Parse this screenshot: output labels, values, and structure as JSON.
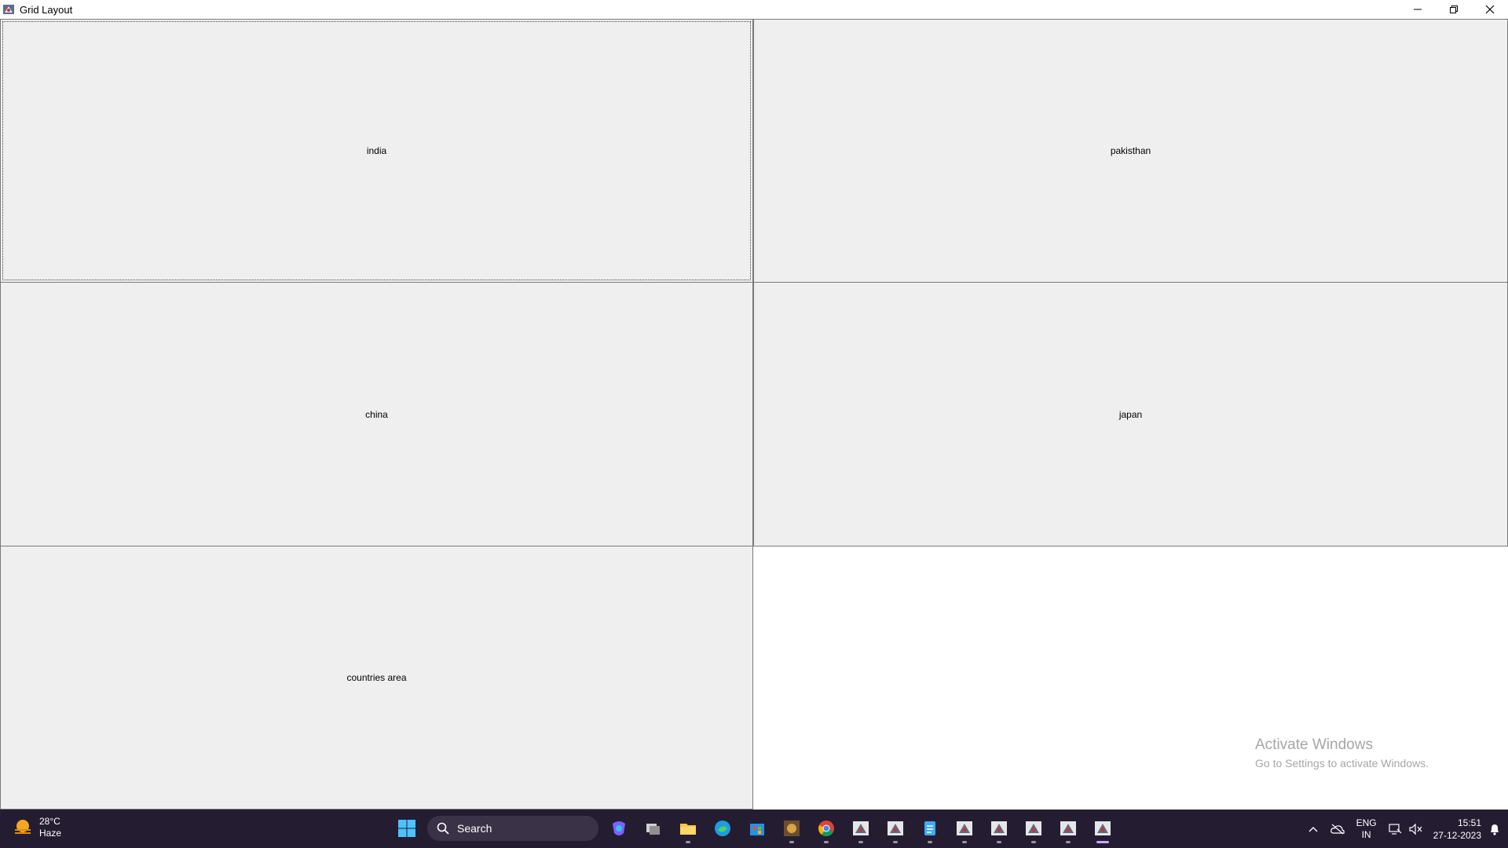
{
  "window": {
    "title": "Grid Layout"
  },
  "grid": {
    "cells": [
      {
        "label": "india"
      },
      {
        "label": "pakisthan"
      },
      {
        "label": "china"
      },
      {
        "label": "japan"
      },
      {
        "label": "countries area"
      }
    ]
  },
  "watermark": {
    "line1": "Activate Windows",
    "line2": "Go to Settings to activate Windows."
  },
  "taskbar": {
    "weather": {
      "temp": "28°C",
      "condition": "Haze"
    },
    "search_label": "Search",
    "tray": {
      "lang_top": "ENG",
      "lang_bottom": "IN",
      "time": "15:51",
      "date": "27-12-2023"
    }
  },
  "colors": {
    "cell_bg": "#efefef",
    "taskbar_bg": "#241d32",
    "accent": "#0078d4"
  }
}
